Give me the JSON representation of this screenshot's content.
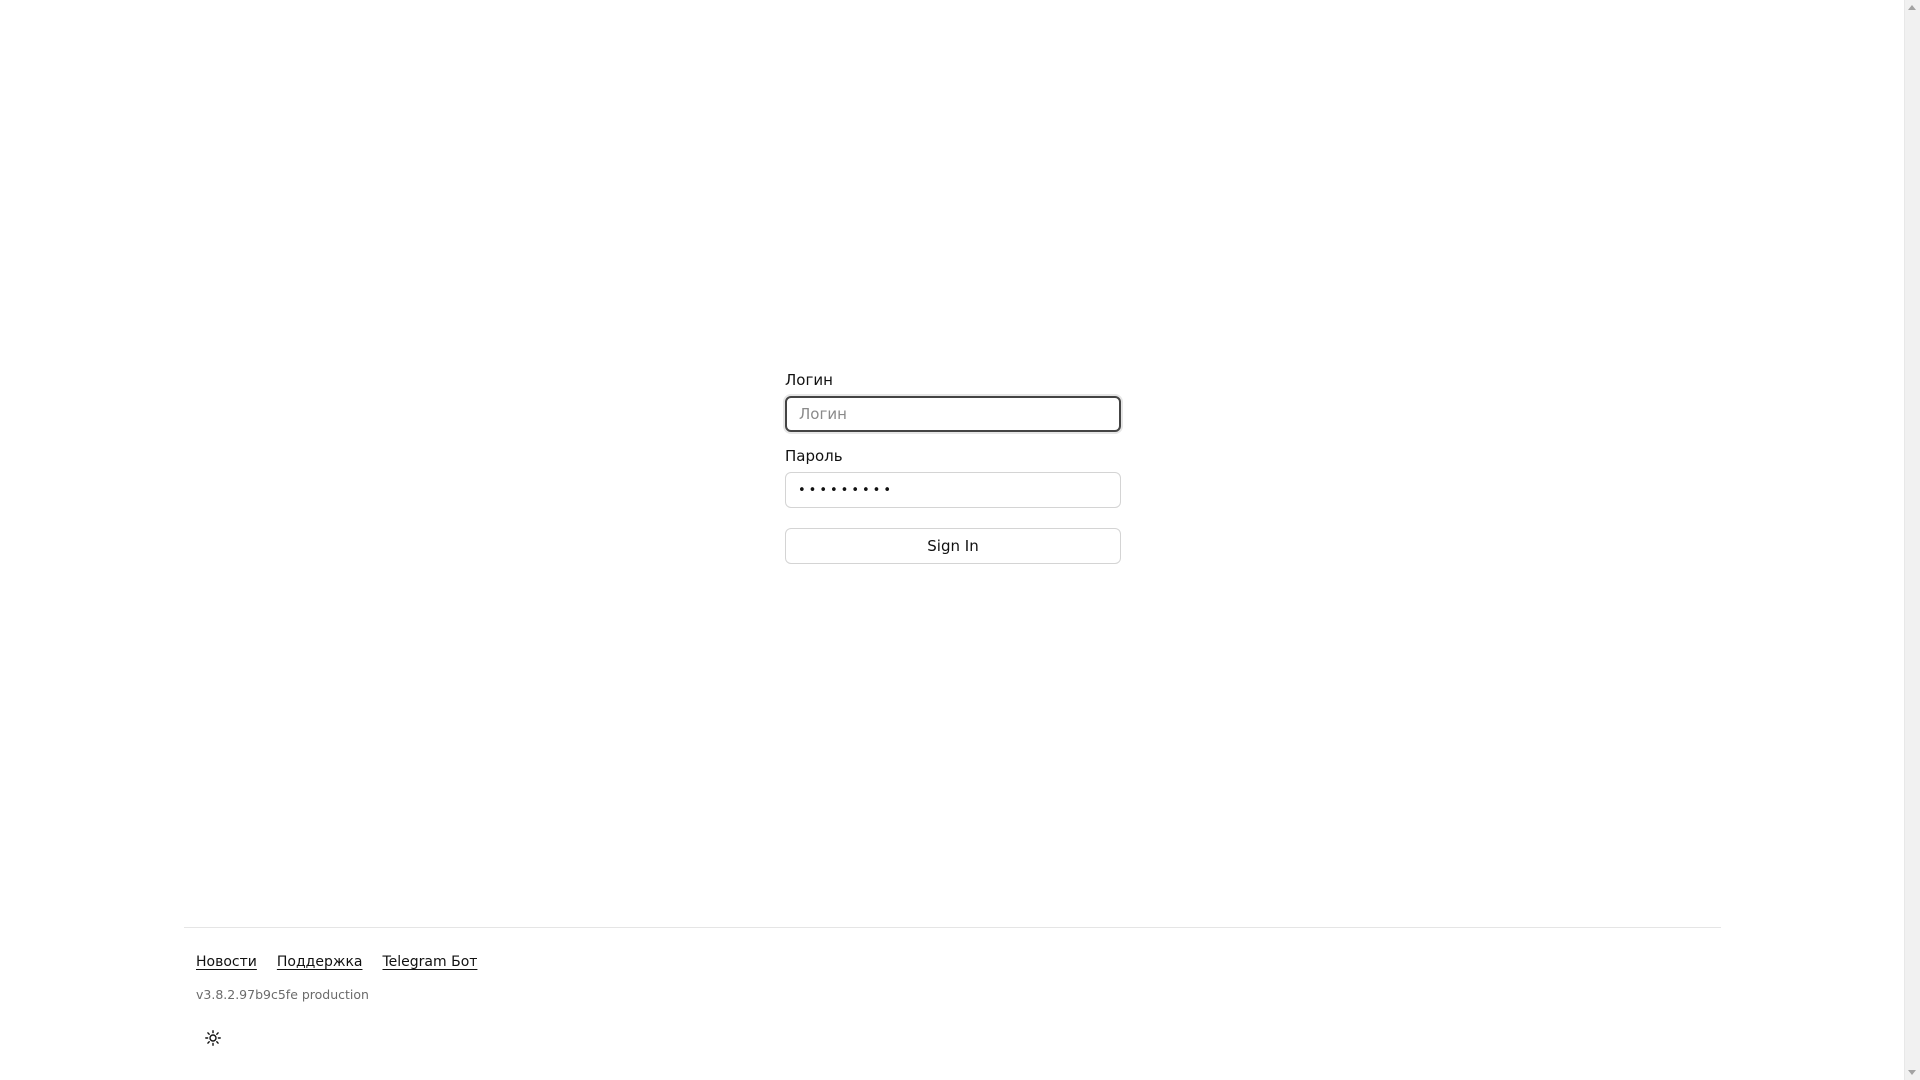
{
  "login": {
    "username_label": "Логин",
    "username_placeholder": "Логин",
    "username_value": "",
    "password_label": "Пароль",
    "password_value": "•••••••••",
    "submit_label": "Sign In"
  },
  "footer": {
    "links": [
      {
        "label": "Новости"
      },
      {
        "label": "Поддержка"
      },
      {
        "label": "Telegram Бот"
      }
    ],
    "version": "v3.8.2.97b9c5fe production",
    "theme_icon": "sun-icon"
  }
}
